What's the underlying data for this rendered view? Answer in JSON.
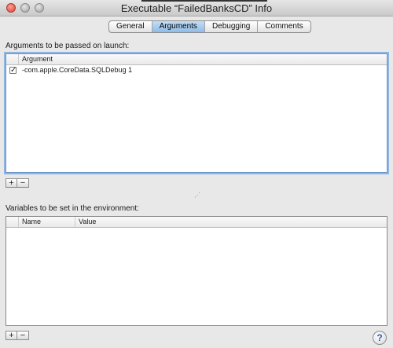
{
  "window": {
    "title": "Executable “FailedBanksCD” Info"
  },
  "tabs": [
    {
      "label": "General"
    },
    {
      "label": "Arguments"
    },
    {
      "label": "Debugging"
    },
    {
      "label": "Comments"
    }
  ],
  "active_tab": "Arguments",
  "arguments": {
    "section_label": "Arguments to be passed on launch:",
    "column_header": "Argument",
    "rows": [
      {
        "checked": true,
        "value": "-com.apple.CoreData.SQLDebug 1"
      }
    ]
  },
  "environment": {
    "section_label": "Variables to be set in the environment:",
    "columns": {
      "name": "Name",
      "value": "Value"
    },
    "rows": []
  },
  "buttons": {
    "add": "+",
    "remove": "−",
    "help": "?"
  },
  "colors": {
    "focus_ring": "#8fb5e3",
    "active_tab": "#8fbbe8"
  }
}
